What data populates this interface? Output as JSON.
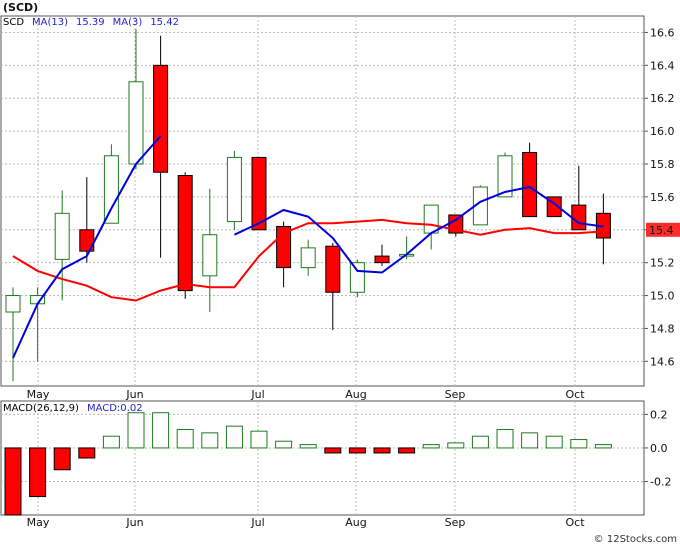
{
  "title": "(SCD)",
  "footer": "© 12Stocks.com",
  "price_legend": [
    {
      "text": "SCD",
      "color": "#000000"
    },
    {
      "text": "MA(13)",
      "color": "#1f1fd6"
    },
    {
      "text": "15.39",
      "color": "#1f1fd6"
    },
    {
      "text": "MA(3)",
      "color": "#1f1fd6"
    },
    {
      "text": "15.42",
      "color": "#1f1fd6"
    }
  ],
  "macd_legend": [
    {
      "text": "MACD(26,12,9)",
      "color": "#000000"
    },
    {
      "text": "MACD:0.02",
      "color": "#1f1fd6"
    }
  ],
  "colors": {
    "up": "#1f7a1f",
    "down_fill": "#ff0000",
    "ma13": "#ff0000",
    "ma3": "#0000dd",
    "grid": "#bbbbbb",
    "panel_bg": "#ffffff",
    "last_price_bg": "#ff2a2a"
  },
  "chart_data": [
    {
      "type": "candlestick",
      "title": "(SCD)",
      "x_ticks": [
        "May",
        "Jun",
        "Jul",
        "Aug",
        "Sep",
        "Oct"
      ],
      "ylim": [
        14.45,
        16.7
      ],
      "y_ticks": [
        "14.6",
        "14.8",
        "15.0",
        "15.2",
        "15.4",
        "15.6",
        "15.8",
        "16.0",
        "16.2",
        "16.4",
        "16.6"
      ],
      "last_price_label": "15.4",
      "candles": [
        {
          "o": 14.9,
          "h": 15.05,
          "l": 14.48,
          "c": 15.0
        },
        {
          "o": 14.95,
          "h": 15.05,
          "l": 14.6,
          "c": 15.0
        },
        {
          "o": 15.22,
          "h": 15.64,
          "l": 14.97,
          "c": 15.5
        },
        {
          "o": 15.4,
          "h": 15.72,
          "l": 15.2,
          "c": 15.27
        },
        {
          "o": 15.44,
          "h": 15.92,
          "l": 15.44,
          "c": 15.85
        },
        {
          "o": 15.8,
          "h": 16.62,
          "l": 15.77,
          "c": 16.3
        },
        {
          "o": 16.4,
          "h": 16.58,
          "l": 15.23,
          "c": 15.75
        },
        {
          "o": 15.73,
          "h": 15.75,
          "l": 14.98,
          "c": 15.03
        },
        {
          "o": 15.12,
          "h": 15.65,
          "l": 14.9,
          "c": 15.37
        },
        {
          "o": 15.45,
          "h": 15.88,
          "l": 15.4,
          "c": 15.84
        },
        {
          "o": 15.84,
          "h": 15.84,
          "l": 15.4,
          "c": 15.4
        },
        {
          "o": 15.42,
          "h": 15.45,
          "l": 15.05,
          "c": 15.17
        },
        {
          "o": 15.17,
          "h": 15.34,
          "l": 15.12,
          "c": 15.29
        },
        {
          "o": 15.3,
          "h": 15.32,
          "l": 14.79,
          "c": 15.02
        },
        {
          "o": 15.02,
          "h": 15.22,
          "l": 14.99,
          "c": 15.2
        },
        {
          "o": 15.24,
          "h": 15.31,
          "l": 15.18,
          "c": 15.2
        },
        {
          "o": 15.24,
          "h": 15.36,
          "l": 15.22,
          "c": 15.25
        },
        {
          "o": 15.38,
          "h": 15.55,
          "l": 15.28,
          "c": 15.55
        },
        {
          "o": 15.49,
          "h": 15.49,
          "l": 15.36,
          "c": 15.38
        },
        {
          "o": 15.43,
          "h": 15.67,
          "l": 15.43,
          "c": 15.66
        },
        {
          "o": 15.6,
          "h": 15.87,
          "l": 15.6,
          "c": 15.85
        },
        {
          "o": 15.87,
          "h": 15.93,
          "l": 15.48,
          "c": 15.48
        },
        {
          "o": 15.6,
          "h": 15.6,
          "l": 15.48,
          "c": 15.48
        },
        {
          "o": 15.55,
          "h": 15.79,
          "l": 15.4,
          "c": 15.4
        },
        {
          "o": 15.5,
          "h": 15.62,
          "l": 15.19,
          "c": 15.35
        }
      ],
      "ma13": [
        15.24,
        15.15,
        15.1,
        15.06,
        14.99,
        14.97,
        15.03,
        15.07,
        15.05,
        15.05,
        15.24,
        15.38,
        15.44,
        15.44,
        15.45,
        15.46,
        15.44,
        15.43,
        15.4,
        15.37,
        15.4,
        15.41,
        15.38,
        15.38,
        15.39
      ],
      "ma3": [
        14.62,
        14.95,
        15.16,
        15.24,
        15.53,
        15.8,
        15.97,
        null,
        null,
        15.37,
        15.44,
        15.52,
        15.48,
        15.35,
        15.15,
        15.14,
        15.25,
        15.38,
        15.46,
        15.57,
        15.63,
        15.66,
        15.56,
        15.44,
        15.42
      ],
      "ma13_start": 0,
      "ma3_start": 0,
      "ma13_skip": [],
      "ma3_gap": [
        7,
        8
      ],
      "ma3_from": 0,
      "ma13_from": 0,
      "series": [
        {
          "name": "MA(13)"
        },
        {
          "name": "MA(3)"
        }
      ]
    },
    {
      "type": "bar",
      "title": "MACD(26,12,9)",
      "x_ticks": [
        "May",
        "Jun",
        "Jul",
        "Aug",
        "Sep",
        "Oct"
      ],
      "ylim": [
        -0.4,
        0.28
      ],
      "y_ticks": [
        "0.2",
        "0.0",
        "-0.2"
      ],
      "values": [
        -0.4,
        -0.29,
        -0.13,
        -0.06,
        0.07,
        0.21,
        0.21,
        0.11,
        0.09,
        0.13,
        0.1,
        0.04,
        0.02,
        -0.03,
        -0.03,
        -0.03,
        -0.03,
        0.02,
        0.03,
        0.07,
        0.11,
        0.09,
        0.07,
        0.05,
        0.02
      ]
    }
  ]
}
